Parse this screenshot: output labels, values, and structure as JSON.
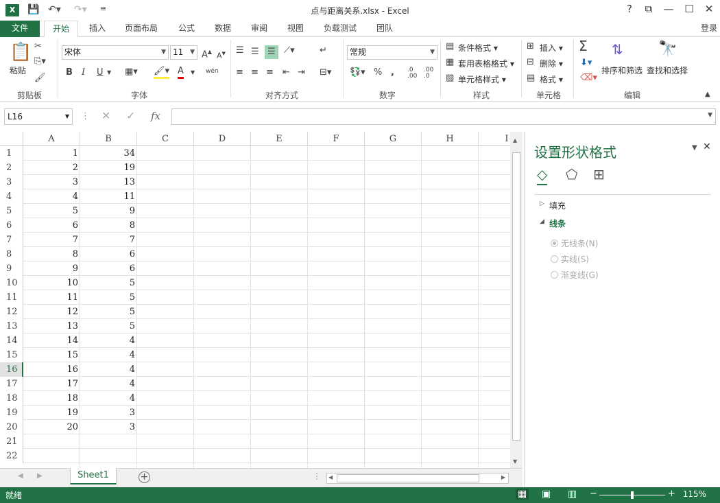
{
  "window": {
    "title": "点与距离关系.xlsx - Excel",
    "app_logo": "X",
    "help": "?",
    "restore_ribbon": "⧉",
    "minimize": "—",
    "maximize": "☐",
    "close": "✕"
  },
  "tabs": {
    "file": "文件",
    "items": [
      "开始",
      "插入",
      "页面布局",
      "公式",
      "数据",
      "审阅",
      "视图",
      "负载测试",
      "团队"
    ],
    "login": "登录"
  },
  "ribbon": {
    "clipboard": {
      "paste": "粘贴",
      "label": "剪贴板"
    },
    "font": {
      "name": "宋体",
      "size": "11",
      "bold": "B",
      "italic": "I",
      "underline": "U",
      "label": "字体",
      "grow": "A",
      "shrink": "A",
      "fontcolor": "A",
      "phonetic": "wén"
    },
    "align": {
      "label": "对齐方式"
    },
    "number": {
      "format": "常规",
      "percent": "%",
      "comma": ",",
      "label": "数字",
      "inc": ".0 .00",
      "dec": ".00 .0"
    },
    "styles": {
      "cond": "条件格式",
      "table": "套用表格格式",
      "cell": "单元格样式",
      "label": "样式"
    },
    "cells": {
      "insert": "插入",
      "delete": "删除",
      "format": "格式",
      "label": "单元格"
    },
    "edit": {
      "sort": "排序和筛选",
      "find": "查找和选择",
      "label": "编辑",
      "sum": "Σ"
    }
  },
  "formula_bar": {
    "name_box": "L16",
    "fx": "fx",
    "value": ""
  },
  "grid": {
    "columns": [
      "A",
      "B",
      "C",
      "D",
      "E",
      "F",
      "G",
      "H",
      "I"
    ],
    "rows": [
      "1",
      "2",
      "3",
      "4",
      "5",
      "6",
      "7",
      "8",
      "9",
      "10",
      "11",
      "12",
      "13",
      "14",
      "15",
      "16",
      "17",
      "18",
      "19",
      "20",
      "21",
      "22"
    ],
    "selected_row": "16",
    "col_a": [
      "1",
      "2",
      "3",
      "4",
      "5",
      "6",
      "7",
      "8",
      "9",
      "10",
      "11",
      "12",
      "13",
      "14",
      "15",
      "16",
      "17",
      "18",
      "19",
      "20"
    ],
    "col_b": [
      "34",
      "19",
      "13",
      "11",
      "9",
      "8",
      "7",
      "6",
      "6",
      "5",
      "5",
      "5",
      "5",
      "4",
      "4",
      "4",
      "4",
      "4",
      "3",
      "3"
    ]
  },
  "sheets": {
    "active": "Sheet1",
    "add": "+"
  },
  "panel": {
    "title": "设置形状格式",
    "fill": "填充",
    "line": "线条",
    "options": [
      "无线条(N)",
      "实线(S)",
      "渐变线(G)"
    ],
    "selected_option": 0
  },
  "status": {
    "ready": "就绪",
    "zoom": "115%"
  },
  "colors": {
    "accent": "#217346"
  }
}
